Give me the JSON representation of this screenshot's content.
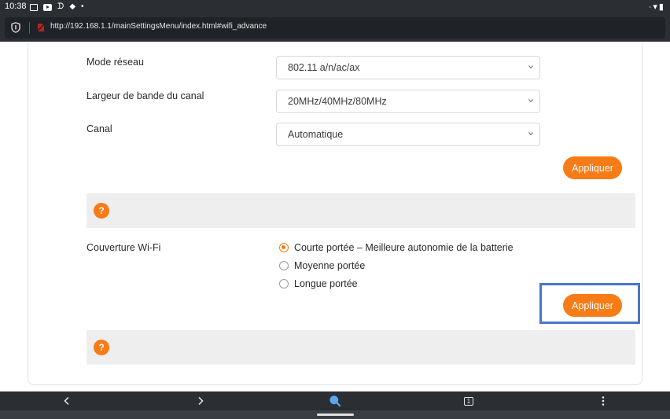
{
  "status_bar": {
    "time": "10:38",
    "right_icons": "·▾▮"
  },
  "url_bar": {
    "url": "http://192.168.1.1/mainSettingsMenu/index.html#wifi_advance"
  },
  "settings": {
    "network_mode": {
      "label": "Mode réseau",
      "value": "802.11 a/n/ac/ax"
    },
    "channel_bandwidth": {
      "label": "Largeur de bande du canal",
      "value": "20MHz/40MHz/80MHz"
    },
    "channel": {
      "label": "Canal",
      "value": "Automatique"
    },
    "apply_label": "Appliquer",
    "help_icon_text": "?"
  },
  "coverage": {
    "label": "Couverture Wi-Fi",
    "options": [
      {
        "label": "Courte portée – Meilleure autonomie de la batterie",
        "checked": true
      },
      {
        "label": "Moyenne portée",
        "checked": false
      },
      {
        "label": "Longue portée",
        "checked": false
      }
    ],
    "apply_label": "Appliquer",
    "help_icon_text": "?"
  },
  "bottom_nav": {
    "tab_count": "1"
  },
  "colors": {
    "accent": "#f77b16",
    "highlight": "#4a76c4",
    "chrome": "#2b2f33"
  }
}
